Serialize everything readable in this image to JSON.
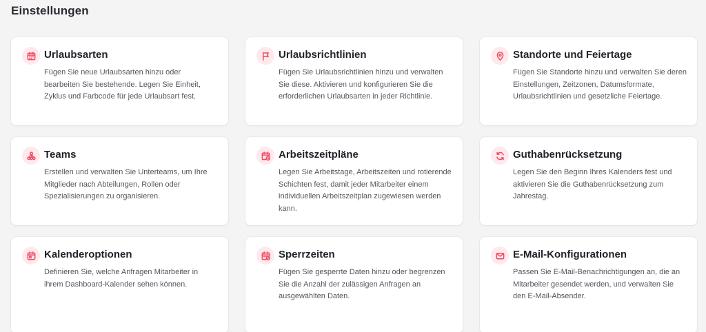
{
  "page": {
    "title": "Einstellungen"
  },
  "accent_color": "#ee4b63",
  "icon_bg_color": "#ffe9ec",
  "cards": [
    {
      "icon": "calendar-icon",
      "title": "Urlaubsarten",
      "description": "Fügen Sie neue Urlaubsarten hinzu oder bearbeiten Sie bestehende. Legen Sie Einheit, Zyklus und Farbcode für jede Urlaubsart fest."
    },
    {
      "icon": "flag-icon",
      "title": "Urlaubsrichtlinien",
      "description": "Fügen Sie Urlaubsrichtlinien hinzu und verwalten Sie diese. Aktivieren und konfigurieren Sie die erforderlichen Urlaubsarten in jeder Richtlinie."
    },
    {
      "icon": "location-pin-icon",
      "title": "Standorte und Feiertage",
      "description": "Fügen Sie Standorte hinzu und verwalten Sie deren Einstellungen, Zeitzonen, Datumsformate, Urlaubsrichtlinien und gesetzliche Feiertage."
    },
    {
      "icon": "team-hierarchy-icon",
      "title": "Teams",
      "description": "Erstellen und verwalten Sie Unterteams, um Ihre Mitglieder nach Abteilungen, Rollen oder Spezialisierungen zu organisieren."
    },
    {
      "icon": "calendar-clock-icon",
      "title": "Arbeitszeitpläne",
      "description": "Legen Sie Arbeitstage, Arbeitszeiten und rotierende Schichten fest, damit jeder Mitarbeiter einem individuellen Arbeitszeitplan zugewiesen werden kann."
    },
    {
      "icon": "refresh-icon",
      "title": "Guthabenrücksetzung",
      "description": "Legen Sie den Beginn Ihres Kalenders fest und aktivieren Sie die Guthabenrücksetzung zum Jahrestag."
    },
    {
      "icon": "calendar-day-icon",
      "title": "Kalenderoptionen",
      "description": "Definieren Sie, welche Anfragen Mitarbeiter in ihrem Dashboard-Kalender sehen können."
    },
    {
      "icon": "calendar-blocked-icon",
      "title": "Sperrzeiten",
      "description": "Fügen Sie gesperrte Daten hinzu oder begrenzen Sie die Anzahl der zulässigen Anfragen an ausgewählten Daten."
    },
    {
      "icon": "email-icon",
      "title": "E-Mail-Konfigurationen",
      "description": "Passen Sie E-Mail-Benachrichtigungen an, die an Mitarbeiter gesendet werden, und verwalten Sie den E-Mail-Absender."
    }
  ]
}
